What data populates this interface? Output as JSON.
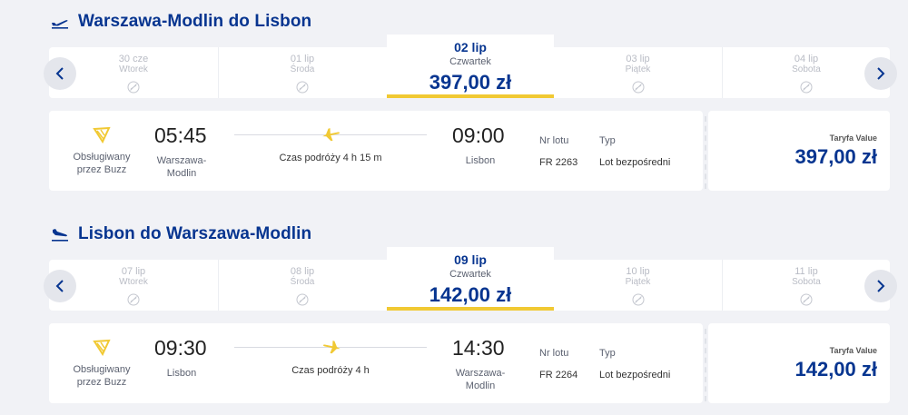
{
  "colors": {
    "brand_blue": "#073590",
    "accent_yellow": "#f1c933",
    "background": "#f1f2f6"
  },
  "outbound": {
    "icon": "plane-takeoff-icon",
    "title": "Warszawa-Modlin do Lisbon",
    "dates": [
      {
        "date": "30 cze",
        "weekday": "Wtorek",
        "icon": "no-flight-icon"
      },
      {
        "date": "01 lip",
        "weekday": "Środa",
        "icon": "no-flight-icon"
      },
      {
        "date": "02 lip",
        "weekday": "Czwartek",
        "price": "397,00 zł",
        "selected": true
      },
      {
        "date": "03 lip",
        "weekday": "Piątek",
        "icon": "no-flight-icon"
      },
      {
        "date": "04 lip",
        "weekday": "Sobota",
        "icon": "no-flight-icon"
      }
    ],
    "flight": {
      "operated_by": "Obsługiwany przez Buzz",
      "departure_time": "05:45",
      "departure_city": "Warszawa-Modlin",
      "duration": "Czas podróży 4 h 15 m",
      "arrival_time": "09:00",
      "arrival_city": "Lisbon",
      "flight_number_label": "Nr lotu",
      "flight_number": "FR 2263",
      "type_label": "Typ",
      "type": "Lot bezpośredni",
      "fare_label": "Taryfa Value",
      "fare_price": "397,00 zł"
    }
  },
  "return": {
    "icon": "plane-landing-icon",
    "title": "Lisbon do Warszawa-Modlin",
    "dates": [
      {
        "date": "07 lip",
        "weekday": "Wtorek",
        "icon": "no-flight-icon"
      },
      {
        "date": "08 lip",
        "weekday": "Środa",
        "icon": "no-flight-icon"
      },
      {
        "date": "09 lip",
        "weekday": "Czwartek",
        "price": "142,00 zł",
        "selected": true
      },
      {
        "date": "10 lip",
        "weekday": "Piątek",
        "icon": "no-flight-icon"
      },
      {
        "date": "11 lip",
        "weekday": "Sobota",
        "icon": "no-flight-icon"
      }
    ],
    "flight": {
      "operated_by": "Obsługiwany przez Buzz",
      "departure_time": "09:30",
      "departure_city": "Lisbon",
      "duration": "Czas podróży 4 h",
      "arrival_time": "14:30",
      "arrival_city": "Warszawa-Modlin",
      "flight_number_label": "Nr lotu",
      "flight_number": "FR 2264",
      "type_label": "Typ",
      "type": "Lot bezpośredni",
      "fare_label": "Taryfa Value",
      "fare_price": "142,00 zł"
    }
  }
}
